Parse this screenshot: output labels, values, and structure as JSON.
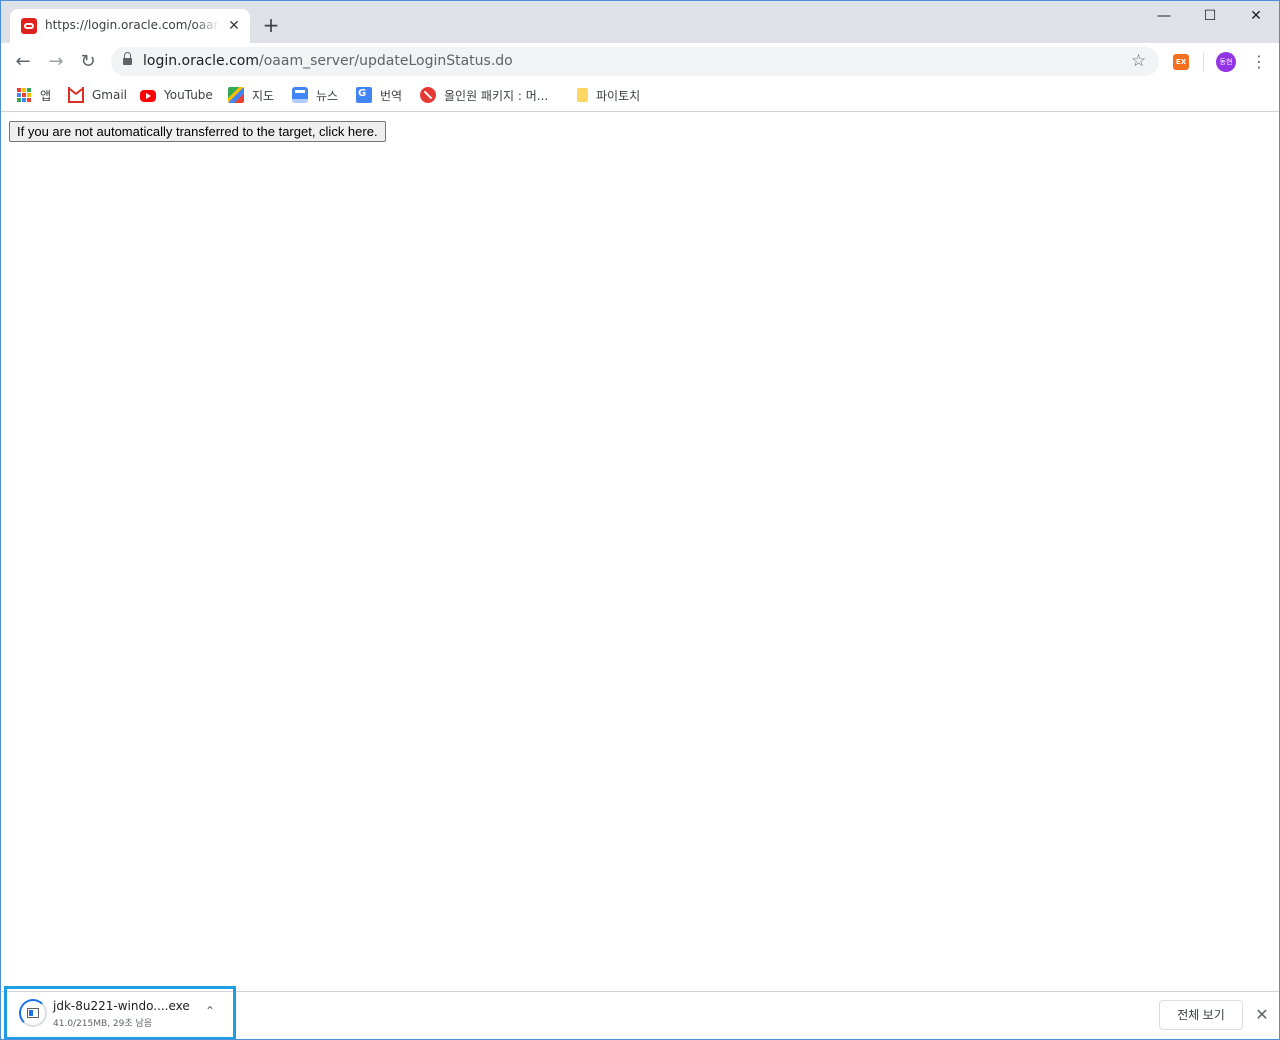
{
  "tab": {
    "title": "https://login.oracle.com/oaam_server/updateLoginStatus.do",
    "close_glyph": "✕",
    "favicon": "oracle-icon"
  },
  "new_tab_glyph": "+",
  "window_controls": {
    "minimize": "—",
    "maximize": "☐",
    "close": "✕"
  },
  "toolbar": {
    "back": "←",
    "forward": "→",
    "reload": "↻",
    "url_host": "login.oracle.com",
    "url_path": "/oaam_server/updateLoginStatus.do",
    "star": "☆",
    "extension_label": "EX",
    "avatar_label": "동현",
    "menu": "⋮"
  },
  "bookmarks": [
    {
      "label": "앱",
      "icon": "apps-icon"
    },
    {
      "label": "Gmail",
      "icon": "gmail-icon"
    },
    {
      "label": "YouTube",
      "icon": "youtube-icon"
    },
    {
      "label": "지도",
      "icon": "maps-icon"
    },
    {
      "label": "뉴스",
      "icon": "news-icon"
    },
    {
      "label": "번역",
      "icon": "translate-icon"
    },
    {
      "label": "올인원 패키지 : 머...",
      "icon": "allinone-icon"
    },
    {
      "label": "파이토치",
      "icon": "folder-icon"
    }
  ],
  "content": {
    "redirect_button": "If you are not automatically transferred to the target, click here."
  },
  "download": {
    "filename": "jdk-8u221-windo....exe",
    "status": "41.0/215MB, 29초 남음",
    "progress_fraction": 0.19,
    "chevron": "⌃",
    "show_all": "전체 보기",
    "close": "✕"
  },
  "colors": {
    "tabstrip_bg": "#dee1e6",
    "highlight_border": "#1e9de0",
    "oracle_red": "#e0221f"
  }
}
